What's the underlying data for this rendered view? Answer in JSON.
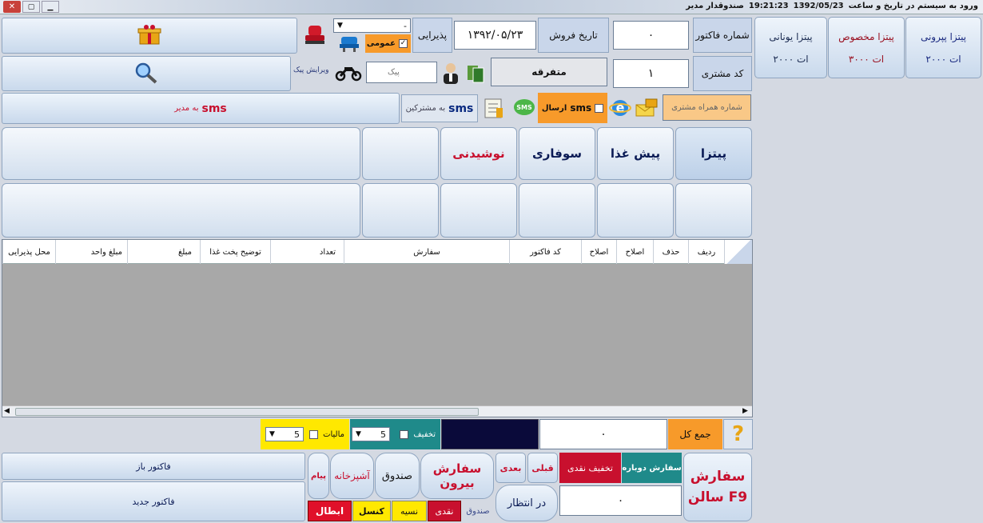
{
  "titlebar": {
    "login_text": "ورود به سیستم در تاریخ و ساعت",
    "date": "1392/05/23",
    "time": "19:21:23",
    "role": "صندوقدار مدیر"
  },
  "pizzas": [
    {
      "name": "پیتزا پپرونی",
      "price": "۲۰۰۰ ات"
    },
    {
      "name": "پیتزا مخصوص",
      "price": "۳۰۰۰ ات"
    },
    {
      "name": "پیتزا یونانی",
      "price": "۲۰۰۰ ات"
    }
  ],
  "top": {
    "invoice_label": "شماره فاکتور",
    "invoice_value": "۰",
    "sale_date_label": "تاریخ فروش",
    "sale_date": "۱۳۹۲/۰۵/۲۳",
    "reception_label": "پذیرایی",
    "general_label": "عمومی",
    "combo_value": "-",
    "customer_code_label": "کد مشتری",
    "customer_code": "۱",
    "customer_name": "متفرقه",
    "courier_placeholder": "پیک",
    "courier_label": "ویرایش پیک",
    "mobile_label": "شماره همراه مشتری",
    "send_sms_label": "ارسال",
    "sms": "sms",
    "sms_subscribers": "به مشترکین",
    "sms_manager": "به مدیر",
    "sms_icon": "SMS"
  },
  "tabs": [
    "پیتزا",
    "پیش غذا",
    "سوفاری",
    "نوشیدنی"
  ],
  "table_headers": [
    "ردیف",
    "حذف",
    "اصلاح",
    "اصلاح",
    "کد فاکتور",
    "سفارش",
    "تعداد",
    "توضیح پخت غذا",
    "مبلغ",
    "مبلغ واحد",
    "محل پذیرایی"
  ],
  "totals": {
    "total_label": "جمع کل",
    "total_value": "۰",
    "discount_label": "تخفیف",
    "discount_value": "5",
    "tax_label": "مالیات",
    "tax_value": "5"
  },
  "actions": {
    "salon": "سفارش",
    "salon2": "سالن F9",
    "reorder": "سفارش دوباره",
    "cash_discount": "تخفیف نقدی",
    "prev": "قبلی",
    "next": "بعدی",
    "outside": "سفارش بیرون",
    "cashbox": "صندوق",
    "kitchen": "آشپزخانه",
    "message": "پیام",
    "waiting": "در انتظار",
    "cashbox_small": "صندوق",
    "cash": "نقدی",
    "credit": "نسیه",
    "cancel": "کنسل",
    "void": "ابطال",
    "cash_discount_value": "۰",
    "open_invoice": "فاکتور باز",
    "new_invoice": "فاکتور جدید"
  },
  "colors": {
    "red": "#c8102e",
    "navy": "#0a1a55",
    "orange": "#f79a2a",
    "teal": "#1f8a8a",
    "yellow": "#ffe800"
  }
}
